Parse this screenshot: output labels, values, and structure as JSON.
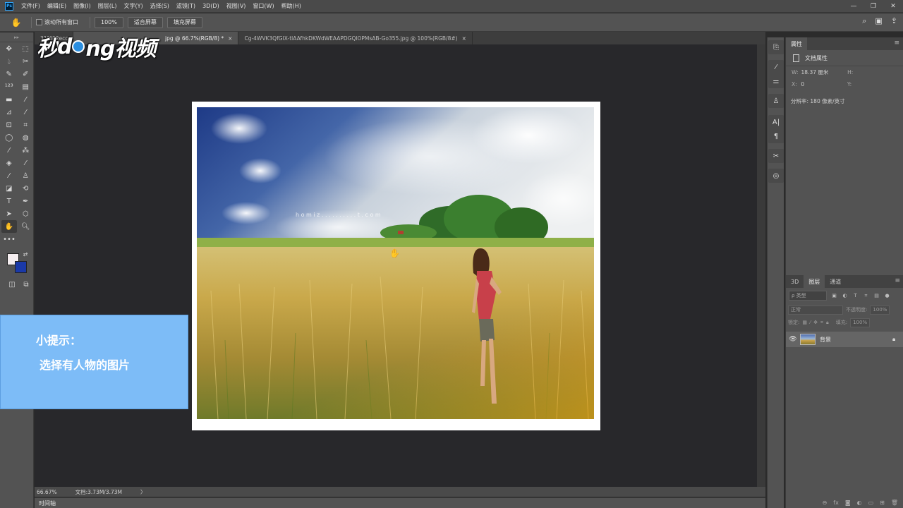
{
  "app": {
    "logo": "Ps"
  },
  "menu": [
    "文件(F)",
    "编辑(E)",
    "图像(I)",
    "图层(L)",
    "文字(Y)",
    "选择(S)",
    "滤镜(T)",
    "3D(D)",
    "视图(V)",
    "窗口(W)",
    "帮助(H)"
  ],
  "window_controls": {
    "minimize": "—",
    "restore": "❐",
    "close": "✕"
  },
  "options": {
    "scroll_all_label": "滚动所有窗口",
    "zoom_btn": "100%",
    "fit_screen_btn": "适合屏幕",
    "fill_screen_btn": "填充屏幕"
  },
  "tabs": [
    {
      "label": "31f482ecc",
      "close": ""
    },
    {
      "label": "jpg @ 66.7%(RGB/8) *",
      "close": "×"
    },
    {
      "label": "Cg-4WVK3QfGIX-tlAAfhkDKWdWEAAPDGQlOPMsAB-Go355.jpg @ 100%(RGB/8#)",
      "close": "×"
    }
  ],
  "watermark": {
    "part1": "秒",
    "part2": "d",
    "part3": "ng视频"
  },
  "photo": {
    "overlay_text": "h o m i z . . . . . . . . . . t . c o m"
  },
  "hint": {
    "title": "小提示：",
    "body": "选择有人物的图片"
  },
  "status": {
    "zoom": "66.67%",
    "doc": "文档:3.73M/3.73M",
    "arrow": "〉"
  },
  "timeline": {
    "label": "时间轴"
  },
  "properties": {
    "tab": "属性",
    "section_title": "文档属性",
    "w_label": "W:",
    "w_value": "18.37 厘米",
    "h_label": "H:",
    "h_value": "",
    "x_label": "X:",
    "x_value": "0",
    "y_label": "Y:",
    "y_value": "",
    "resolution": "分辨率: 180 像素/英寸"
  },
  "layers_panel": {
    "tabs": [
      "3D",
      "图层",
      "通道"
    ],
    "kind_placeholder": "ρ 类型",
    "blend_mode": "正常",
    "opacity_label": "不透明度:",
    "opacity_value": "100%",
    "lock_label": "锁定:",
    "fill_label": "填充:",
    "fill_value": "100%",
    "layer_name": "背景"
  }
}
